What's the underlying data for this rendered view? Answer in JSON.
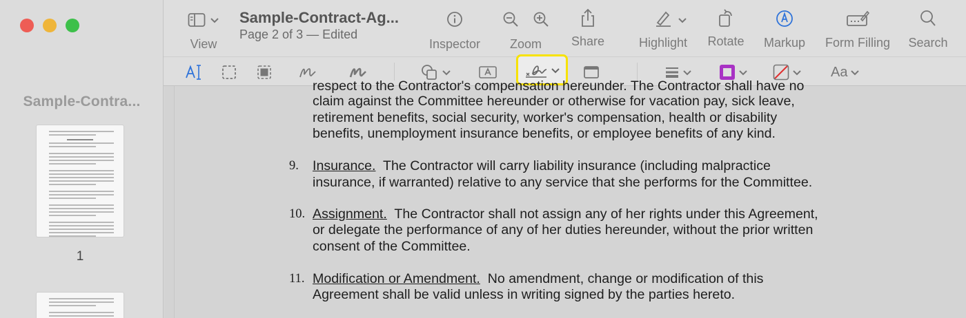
{
  "window": {
    "sidebar_title": "Sample-Contra...",
    "thumbnail_page_number": "1"
  },
  "toolbar": {
    "view_label": "View",
    "doc_title": "Sample-Contract-Ag...",
    "doc_subtitle": "Page 2 of 3 — Edited",
    "inspector_label": "Inspector",
    "zoom_label": "Zoom",
    "share_label": "Share",
    "highlight_label": "Highlight",
    "rotate_label": "Rotate",
    "markup_label": "Markup",
    "form_filling_label": "Form Filling",
    "search_label": "Search",
    "text_style_label": "Aa"
  },
  "colors": {
    "accent": "#2f73d9",
    "highlight_border": "#f7e200",
    "border_color_swatch": "#a832c4",
    "fill_color_swatch": "#e03030"
  },
  "document": {
    "cont_lines": [
      "respect to the Contractor's compensation hereunder.  The Contractor shall have no",
      "claim against the Committee hereunder or otherwise for vacation pay, sick leave,",
      "retirement benefits, social security, worker's compensation, health or disability",
      "benefits, unemployment insurance benefits, or employee benefits of any kind."
    ],
    "items": [
      {
        "number": "9.",
        "heading": "Insurance.",
        "first_line": "  The Contractor will carry liability insurance (including malpractice",
        "lines": [
          "insurance, if warranted) relative to any service that she performs for the Committee."
        ]
      },
      {
        "number": "10.",
        "heading": "Assignment.",
        "first_line": "  The Contractor shall not assign any of her rights under this Agreement,",
        "lines": [
          "or delegate the performance of any of her duties hereunder, without the prior written",
          "consent of the Committee."
        ]
      },
      {
        "number": "11.",
        "heading": "Modification or Amendment.",
        "first_line": "  No amendment, change or modification of this",
        "lines": [
          "Agreement shall be valid unless in writing signed by the parties hereto."
        ]
      }
    ]
  }
}
